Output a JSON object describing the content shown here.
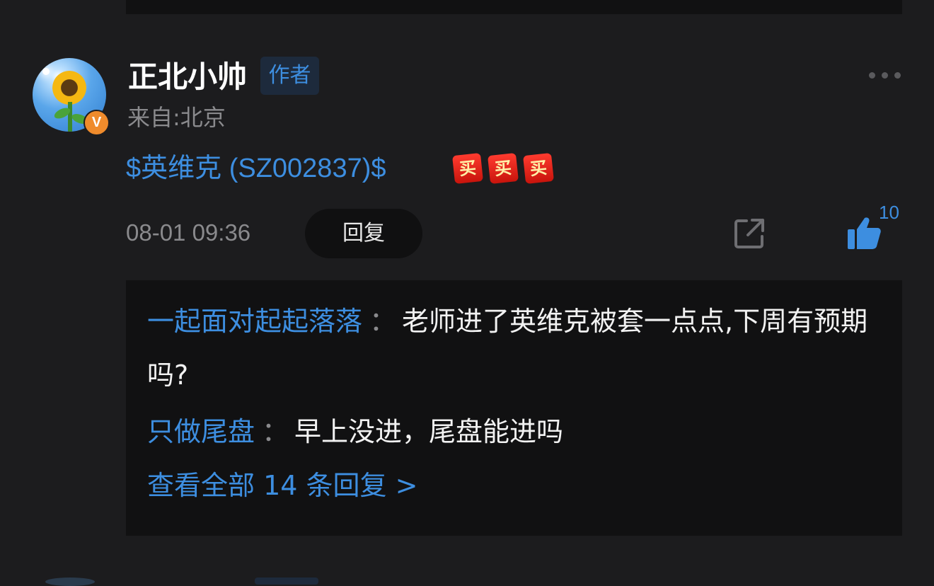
{
  "comment": {
    "username": "正北小帅",
    "author_badge": "作者",
    "location": "来自:北京",
    "verified_mark": "V",
    "stock_link": "$英维克 (SZ002837)$",
    "emojis": [
      "买",
      "买",
      "买"
    ],
    "timestamp": "08-01 09:36",
    "reply_button": "回复",
    "like_count": "10"
  },
  "replies": [
    {
      "author": "一起面对起起落落",
      "separator": "：",
      "text": "老师进了英维克被套一点点,下周有预期吗?"
    },
    {
      "author": "只做尾盘",
      "separator": "：",
      "text": "早上没进，尾盘能进吗"
    }
  ],
  "view_all": "查看全部 14 条回复 >",
  "colors": {
    "background": "#1c1c1e",
    "accent": "#3d8ee0",
    "muted": "#8a8a8d",
    "panel": "#111112",
    "verified": "#ef8b2c"
  },
  "icons": [
    "more-icon",
    "share-icon",
    "thumbs-up-icon",
    "verified-icon"
  ]
}
